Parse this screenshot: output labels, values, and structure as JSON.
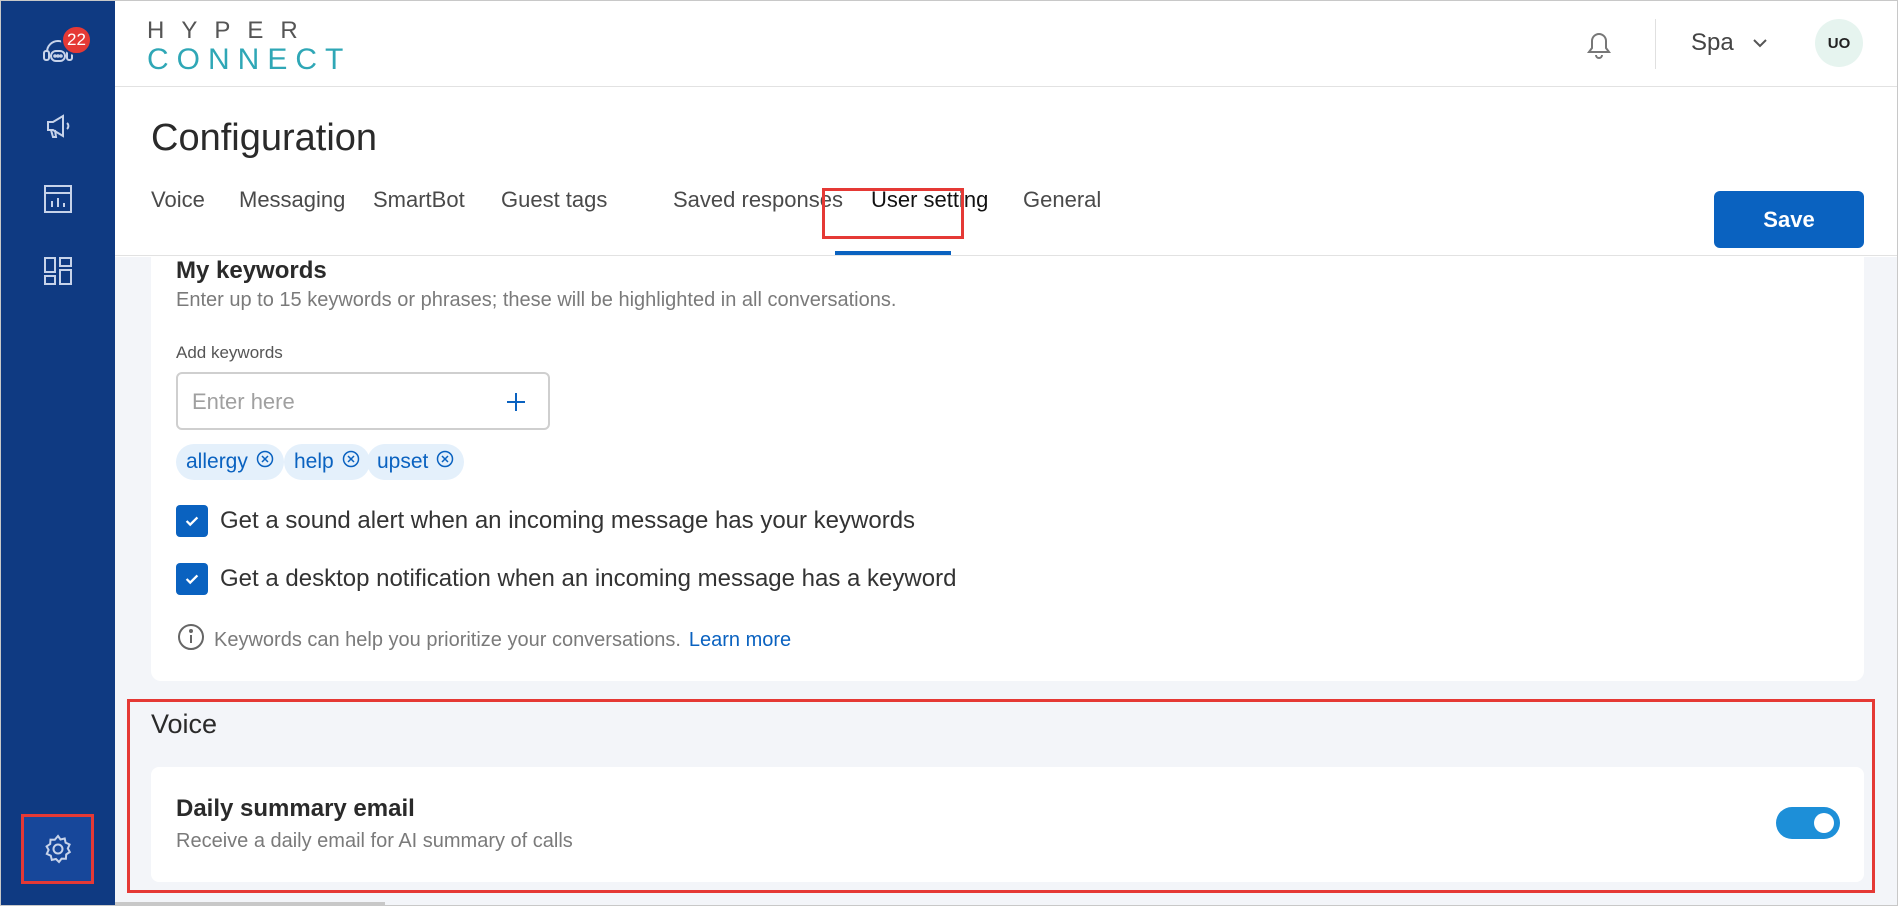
{
  "sidebar": {
    "notification_count": "22",
    "items": [
      {
        "icon": "support-agent-icon"
      },
      {
        "icon": "megaphone-icon"
      },
      {
        "icon": "analytics-icon"
      },
      {
        "icon": "dashboard-grid-icon"
      },
      {
        "icon": "gear-icon"
      }
    ]
  },
  "header": {
    "logo_top": "HYPER",
    "logo_bottom": "CONNECT",
    "language": "Spa",
    "avatar_initials": "UO"
  },
  "page": {
    "title": "Configuration",
    "tabs": [
      {
        "label": "Voice"
      },
      {
        "label": "Messaging"
      },
      {
        "label": "SmartBot"
      },
      {
        "label": "Guest tags"
      },
      {
        "label": "Saved responses"
      },
      {
        "label": "User setting"
      },
      {
        "label": "General"
      }
    ],
    "active_tab": "User setting",
    "save_label": "Save"
  },
  "keywords": {
    "title": "My keywords",
    "description": "Enter up to 15 keywords or phrases; these will be highlighted in all conversations.",
    "input_label": "Add keywords",
    "input_placeholder": "Enter here",
    "chips": [
      "allergy",
      "help",
      "upset"
    ],
    "sound_alert_label": "Get a sound alert when an incoming message has your keywords",
    "desktop_notification_label": "Get a desktop notification when an incoming message has a keyword",
    "info_text": "Keywords can help you prioritize your conversations.",
    "learn_more": "Learn more"
  },
  "voice": {
    "title": "Voice",
    "daily_summary_title": "Daily summary email",
    "daily_summary_desc": "Receive a daily email for AI summary of calls"
  },
  "colors": {
    "sidebar": "#0f3a82",
    "accent": "#0a62c0",
    "highlight": "#e53935",
    "toggle_on": "#1d8fd8"
  }
}
